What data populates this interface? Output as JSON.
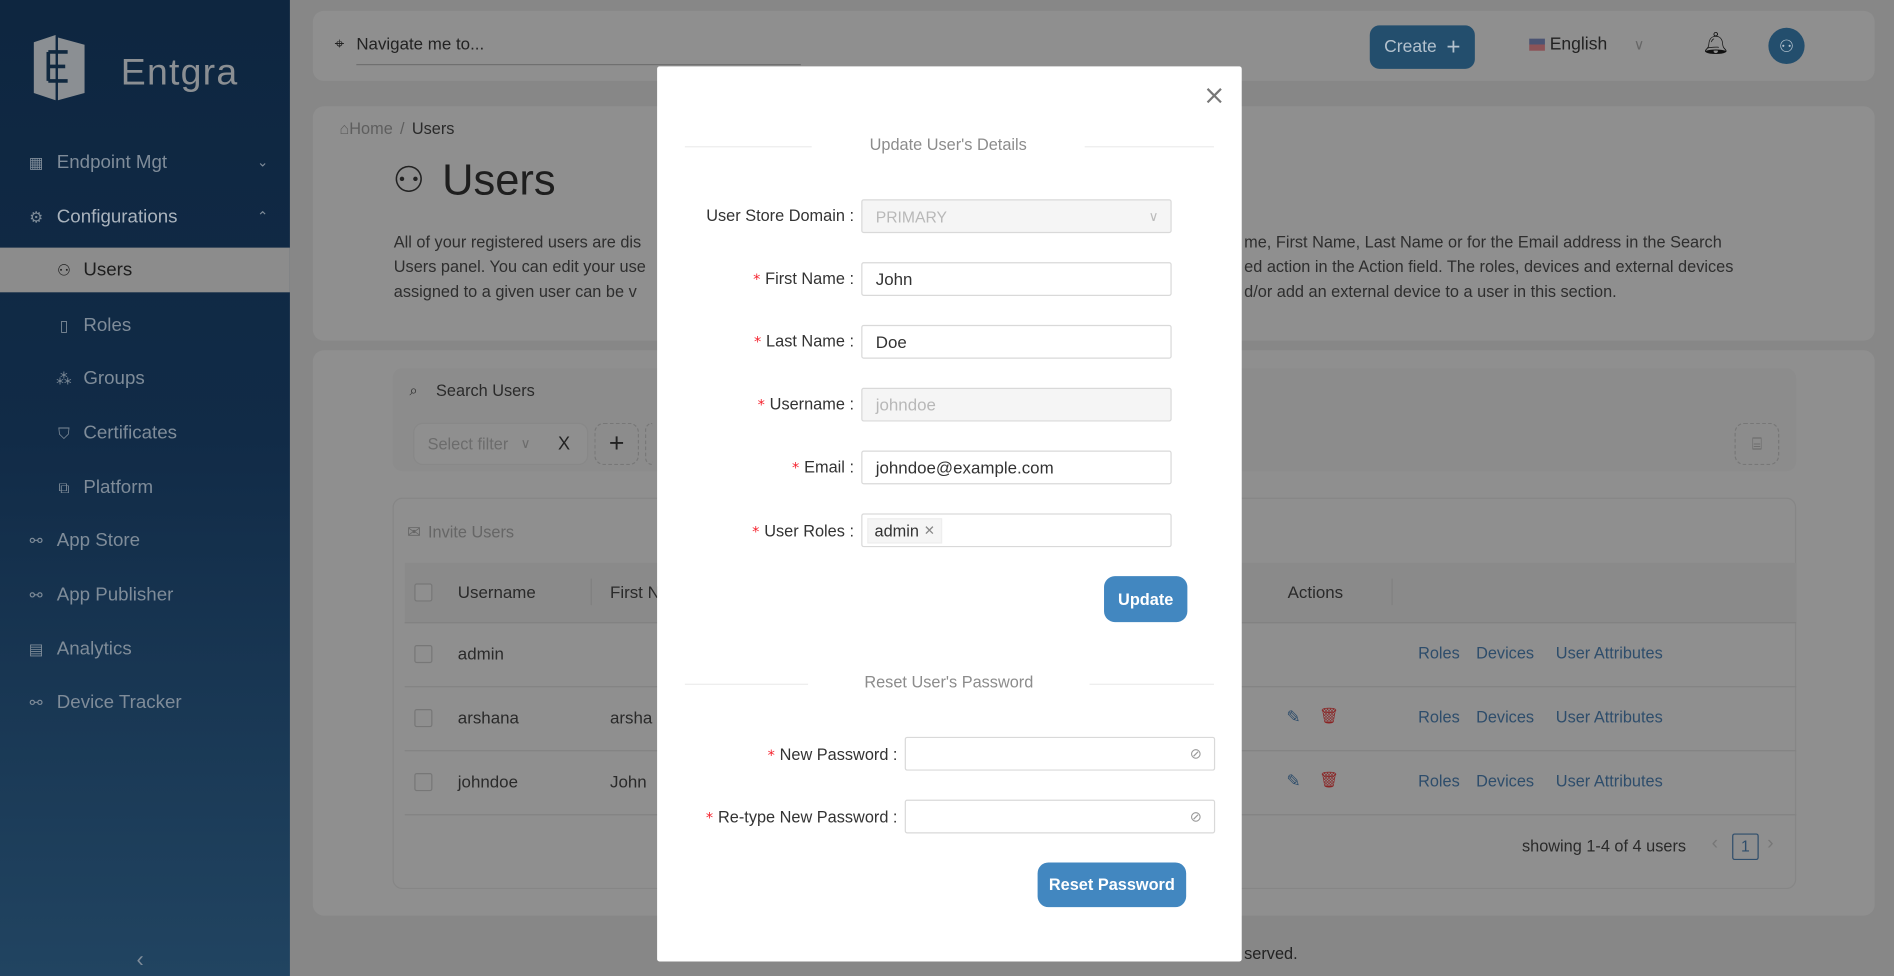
{
  "brand": {
    "name": "Entgra"
  },
  "colors": {
    "accent": "#4287c0",
    "required": "#f5222d",
    "sidebar": "#0e2640"
  },
  "sidebar": {
    "items": [
      {
        "label": "Endpoint Mgt",
        "icon": "grid-icon",
        "expanded": false
      },
      {
        "label": "Configurations",
        "icon": "gear-icon",
        "expanded": true
      },
      {
        "label": "Users",
        "icon": "user-icon",
        "active": true
      },
      {
        "label": "Roles",
        "icon": "book-icon"
      },
      {
        "label": "Groups",
        "icon": "network-icon"
      },
      {
        "label": "Certificates",
        "icon": "shield-icon"
      },
      {
        "label": "Platform",
        "icon": "sliders-icon"
      },
      {
        "label": "App Store",
        "icon": "plug-icon"
      },
      {
        "label": "App Publisher",
        "icon": "plug-icon"
      },
      {
        "label": "Analytics",
        "icon": "building-icon"
      },
      {
        "label": "Device Tracker",
        "icon": "plug-icon"
      }
    ],
    "collapse_icon": "chevron-left-icon"
  },
  "header": {
    "nav_placeholder": "Navigate me to...",
    "create_label": "Create",
    "language": "English"
  },
  "breadcrumb": {
    "home": "Home",
    "sep": "/",
    "current": "Users"
  },
  "page": {
    "title": "Users",
    "desc_left": [
      "All of your registered users are dis",
      "Users panel. You can edit your use",
      "assigned to a given user can be v"
    ],
    "desc_right": [
      "me, First Name, Last Name or for the Email address in the Search",
      "ed action in the Action field. The roles, devices and external devices",
      "d/or add an external device to a user in this section."
    ]
  },
  "search": {
    "title": "Search Users",
    "filter_placeholder": "Select filter",
    "clear": "X",
    "add": "+"
  },
  "table": {
    "invite_label": "Invite Users",
    "headers": {
      "username": "Username",
      "first_name": "First N",
      "actions": "Actions"
    },
    "rows": [
      {
        "username": "admin",
        "first_name": "",
        "editable": false
      },
      {
        "username": "arshana",
        "first_name": "arsha",
        "editable": true
      },
      {
        "username": "johndoe",
        "first_name": "John",
        "editable": true
      }
    ],
    "links": {
      "roles": "Roles",
      "devices": "Devices",
      "attributes": "User Attributes"
    },
    "pagination": {
      "summary": "showing 1-4 of 4 users",
      "page": "1",
      "prev": "‹",
      "next": "›"
    }
  },
  "footer": {
    "visible_text": "served."
  },
  "modal": {
    "close": "×",
    "details_title": "Update User's Details",
    "fields": {
      "domain": {
        "label": "User Store Domain",
        "value": "PRIMARY"
      },
      "first_name": {
        "label": "First Name",
        "value": "John"
      },
      "last_name": {
        "label": "Last Name",
        "value": "Doe"
      },
      "username": {
        "label": "Username",
        "value": "johndoe"
      },
      "email": {
        "label": "Email",
        "value": "johndoe@example.com"
      },
      "roles": {
        "label": "User Roles",
        "tags": [
          "admin"
        ]
      }
    },
    "update_label": "Update",
    "reset_title": "Reset User's Password",
    "new_password": {
      "label": "New Password",
      "value": ""
    },
    "retype_password": {
      "label": "Re-type New Password",
      "value": ""
    },
    "reset_label": "Reset Password"
  }
}
